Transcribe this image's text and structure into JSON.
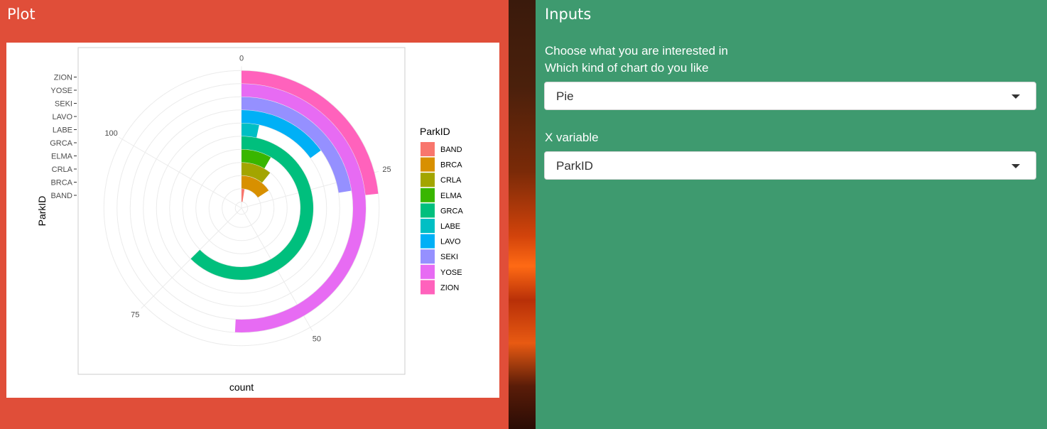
{
  "plot_panel": {
    "title": "Plot"
  },
  "inputs_panel": {
    "title": "Inputs",
    "intro": "Choose what you are interested in",
    "chart_kind_label": "Which kind of chart do you like",
    "chart_kind_value": "Pie",
    "x_variable_label": "X variable",
    "x_variable_value": "ParkID"
  },
  "chart_data": {
    "type": "bar",
    "coord": "polar",
    "xlabel": "count",
    "ylabel": "ParkID",
    "legend_title": "ParkID",
    "legend_position": "right",
    "grid": true,
    "categories": [
      "BAND",
      "BRCA",
      "CRLA",
      "ELMA",
      "GRCA",
      "LABE",
      "LAVO",
      "SEKI",
      "YOSE",
      "ZION"
    ],
    "values": [
      3,
      19,
      13,
      10,
      75,
      4,
      18,
      27,
      61,
      28
    ],
    "colors": [
      "#f8766d",
      "#d89000",
      "#a3a500",
      "#39b600",
      "#00bf7d",
      "#00bfc4",
      "#00b0f6",
      "#9590ff",
      "#e76bf3",
      "#ff62bc"
    ],
    "angle_ticks": [
      "0",
      "25",
      "50",
      "75",
      "100"
    ],
    "angle_tick_values": [
      0,
      25,
      50,
      75,
      100
    ],
    "angle_max": 120
  }
}
